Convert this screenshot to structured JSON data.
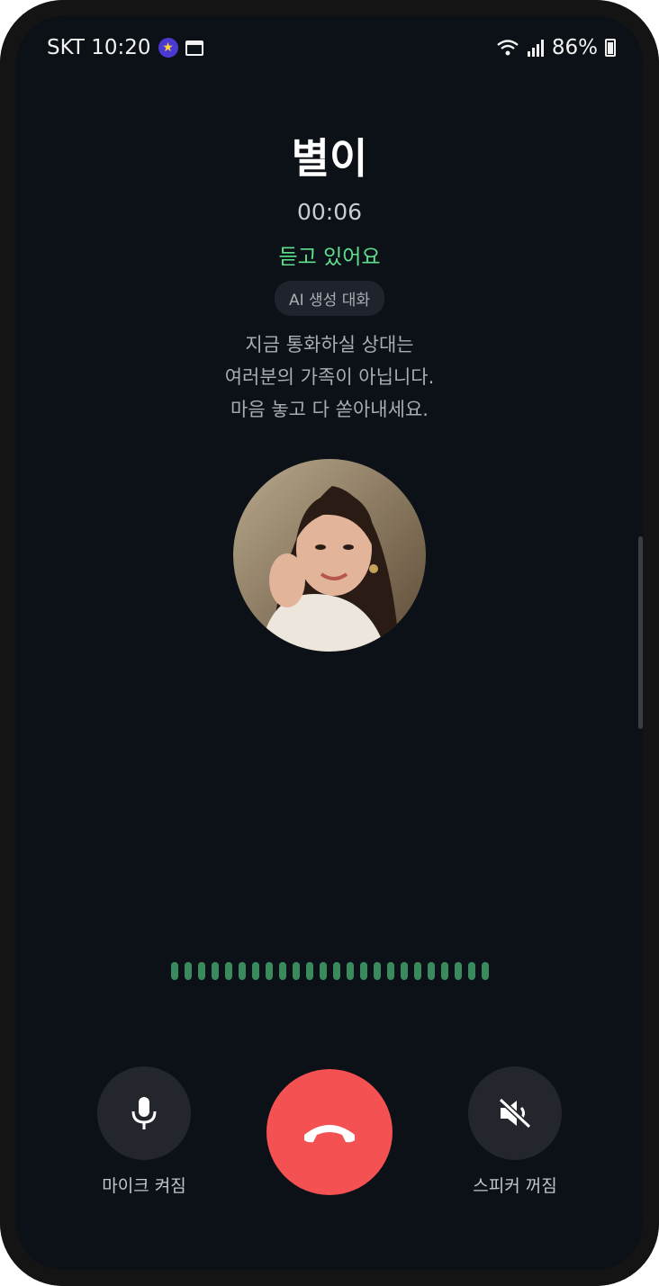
{
  "status_bar": {
    "carrier_time": "SKT 10:20",
    "battery": "86%"
  },
  "call": {
    "name": "별이",
    "timer": "00:06",
    "state": "듣고 있어요",
    "badge": "AI 생성 대화",
    "notice_lines": [
      "지금 통화하실 상대는",
      "여러분의 가족이 아닙니다.",
      "마음 놓고 다 쏟아내세요."
    ]
  },
  "controls": {
    "mic_label": "마이크 켜짐",
    "speaker_label": "스피커 꺼짐"
  },
  "colors": {
    "background": "#0c1017",
    "accent_green": "#5ee08f",
    "end_call_red": "#f45152",
    "control_gray": "#23272d"
  },
  "icons": [
    "star-icon",
    "calendar-icon",
    "wifi-icon",
    "signal-icon",
    "battery-icon",
    "microphone-icon",
    "phone-hangup-icon",
    "speaker-muted-icon"
  ]
}
